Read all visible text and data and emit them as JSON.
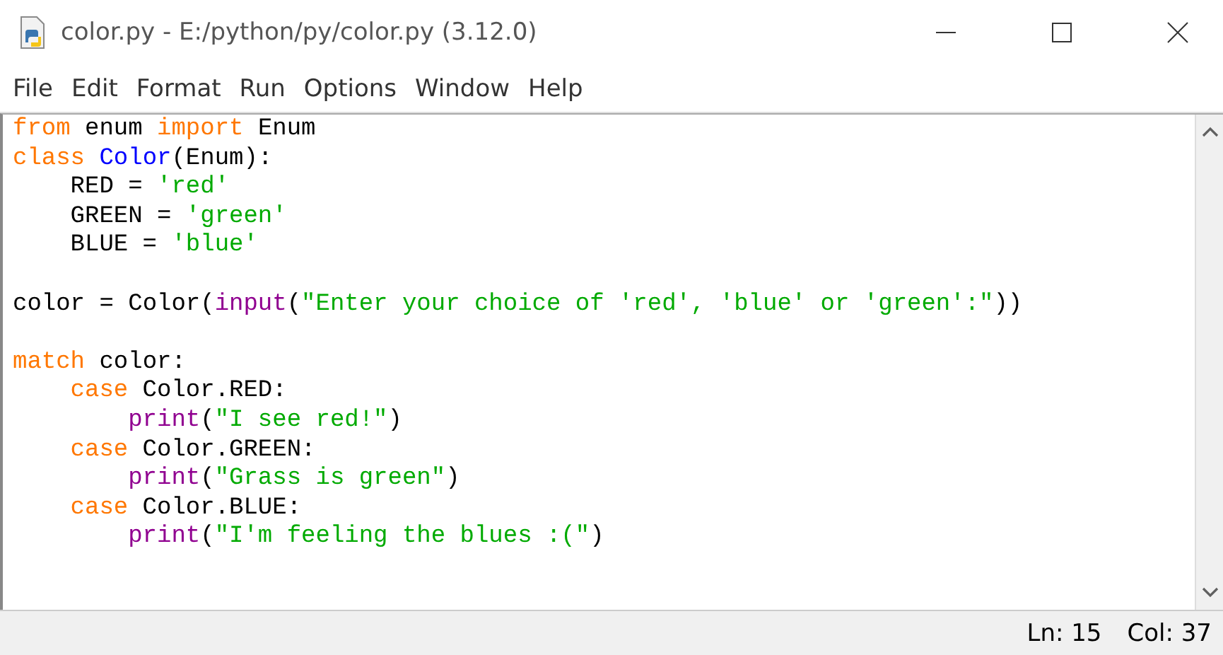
{
  "window": {
    "title": "color.py - E:/python/py/color.py (3.12.0)"
  },
  "menu": [
    "File",
    "Edit",
    "Format",
    "Run",
    "Options",
    "Window",
    "Help"
  ],
  "editor": {
    "lines": [
      {
        "kind": "code",
        "tokens": [
          {
            "kind": "keyword",
            "text": "from"
          },
          {
            "kind": "plain",
            "text": " enum "
          },
          {
            "kind": "keyword",
            "text": "import"
          },
          {
            "kind": "plain",
            "text": " Enum"
          }
        ]
      },
      {
        "kind": "code",
        "tokens": [
          {
            "kind": "keyword",
            "text": "class "
          },
          {
            "kind": "definition",
            "text": "Color"
          },
          {
            "kind": "plain",
            "text": "(Enum):"
          }
        ],
        "children": [
          {
            "kind": "code",
            "tokens": [
              {
                "kind": "plain",
                "text": "RED = "
              },
              {
                "kind": "string",
                "text": "'red'"
              }
            ]
          },
          {
            "kind": "code",
            "tokens": [
              {
                "kind": "plain",
                "text": "GREEN = "
              },
              {
                "kind": "string",
                "text": "'green'"
              }
            ]
          },
          {
            "kind": "code",
            "tokens": [
              {
                "kind": "plain",
                "text": "BLUE = "
              },
              {
                "kind": "string",
                "text": "'blue'"
              }
            ]
          }
        ]
      },
      {
        "kind": "blank"
      },
      {
        "kind": "code",
        "tokens": [
          {
            "kind": "plain",
            "text": "color = Color("
          },
          {
            "kind": "builtin",
            "text": "input"
          },
          {
            "kind": "plain",
            "text": "("
          },
          {
            "kind": "string",
            "text": "\"Enter your choice of 'red', 'blue' or 'green':\""
          },
          {
            "kind": "plain",
            "text": "))"
          }
        ]
      },
      {
        "kind": "blank"
      },
      {
        "kind": "code",
        "tokens": [
          {
            "kind": "keyword",
            "text": "match"
          },
          {
            "kind": "plain",
            "text": " color:"
          }
        ],
        "children": [
          {
            "kind": "code",
            "tokens": [
              {
                "kind": "keyword",
                "text": "case"
              },
              {
                "kind": "plain",
                "text": " Color.RED:"
              }
            ],
            "children": [
              {
                "kind": "code",
                "tokens": [
                  {
                    "kind": "builtin",
                    "text": "print"
                  },
                  {
                    "kind": "plain",
                    "text": "("
                  },
                  {
                    "kind": "string",
                    "text": "\"I see red!\""
                  },
                  {
                    "kind": "plain",
                    "text": ")"
                  }
                ]
              }
            ]
          },
          {
            "kind": "code",
            "tokens": [
              {
                "kind": "keyword",
                "text": "case"
              },
              {
                "kind": "plain",
                "text": " Color.GREEN:"
              }
            ],
            "children": [
              {
                "kind": "code",
                "tokens": [
                  {
                    "kind": "builtin",
                    "text": "print"
                  },
                  {
                    "kind": "plain",
                    "text": "("
                  },
                  {
                    "kind": "string",
                    "text": "\"Grass is green\""
                  },
                  {
                    "kind": "plain",
                    "text": ")"
                  }
                ]
              }
            ]
          },
          {
            "kind": "code",
            "tokens": [
              {
                "kind": "keyword",
                "text": "case"
              },
              {
                "kind": "plain",
                "text": " Color.BLUE:"
              }
            ],
            "children": [
              {
                "kind": "code",
                "tokens": [
                  {
                    "kind": "builtin",
                    "text": "print"
                  },
                  {
                    "kind": "plain",
                    "text": "("
                  },
                  {
                    "kind": "string",
                    "text": "\"I'm feeling the blues :(\""
                  },
                  {
                    "kind": "plain",
                    "text": ")"
                  }
                ]
              }
            ]
          }
        ]
      }
    ]
  },
  "status_bar": {
    "line": "Ln: 15",
    "column": "Col: 37"
  }
}
